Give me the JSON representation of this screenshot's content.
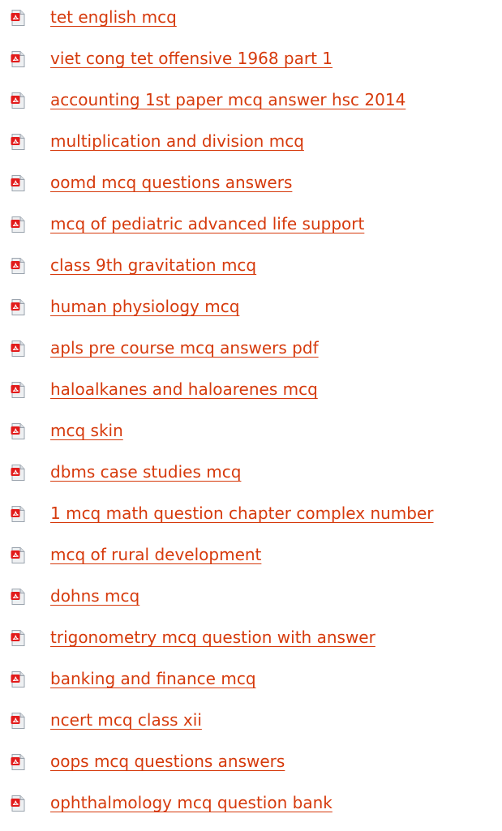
{
  "colors": {
    "link": "#d63a0c",
    "icon_red": "#e21b1b",
    "icon_paper": "#eef0f2",
    "icon_border": "#9aa3ad"
  },
  "links": [
    {
      "label": "tet english mcq",
      "icon": "pdf-file-icon"
    },
    {
      "label": "viet cong tet offensive 1968 part 1",
      "icon": "pdf-file-icon"
    },
    {
      "label": "accounting 1st paper mcq answer hsc 2014",
      "icon": "pdf-file-icon"
    },
    {
      "label": "multiplication and division mcq",
      "icon": "pdf-file-icon"
    },
    {
      "label": "oomd mcq questions answers",
      "icon": "pdf-file-icon"
    },
    {
      "label": "mcq of pediatric advanced life support",
      "icon": "pdf-file-icon"
    },
    {
      "label": "class 9th gravitation mcq",
      "icon": "pdf-file-icon"
    },
    {
      "label": "human physiology mcq",
      "icon": "pdf-file-icon"
    },
    {
      "label": "apls pre course mcq answers pdf",
      "icon": "pdf-file-icon"
    },
    {
      "label": "haloalkanes and haloarenes mcq",
      "icon": "pdf-file-icon"
    },
    {
      "label": "mcq skin",
      "icon": "pdf-file-icon"
    },
    {
      "label": "dbms case studies mcq",
      "icon": "pdf-file-icon"
    },
    {
      "label": "1 mcq math question chapter complex number",
      "icon": "pdf-file-icon"
    },
    {
      "label": "mcq of rural development",
      "icon": "pdf-file-icon"
    },
    {
      "label": "dohns mcq",
      "icon": "pdf-file-icon"
    },
    {
      "label": "trigonometry mcq question with answer",
      "icon": "pdf-file-icon"
    },
    {
      "label": "banking and finance mcq",
      "icon": "pdf-file-icon"
    },
    {
      "label": "ncert mcq class xii",
      "icon": "pdf-file-icon"
    },
    {
      "label": "oops mcq questions answers",
      "icon": "pdf-file-icon"
    },
    {
      "label": "ophthalmology mcq question bank",
      "icon": "pdf-file-icon"
    }
  ]
}
